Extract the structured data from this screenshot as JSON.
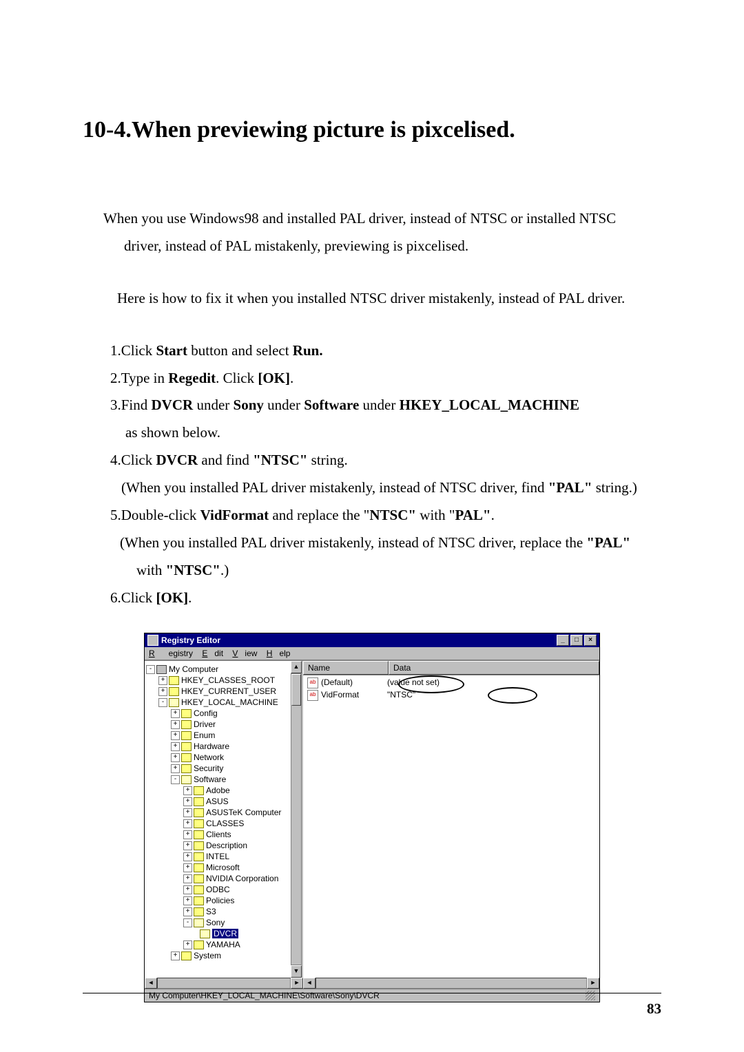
{
  "heading": "10-4.When previewing picture is pixcelised.",
  "p1a": "When you use Windows98 and installed PAL driver, instead of NTSC or installed NTSC",
  "p1b": "driver, instead of PAL mistakenly, previewing is pixcelised.",
  "p2": "Here is how to fix it when you installed NTSC driver mistakenly, instead of PAL driver.",
  "s1_pre": "1.Click ",
  "s1_b1": "Start",
  "s1_mid": " button and select ",
  "s1_b2": "Run.",
  "s2_pre": "2.Type in ",
  "s2_b1": "Regedit",
  "s2_mid": ". Click ",
  "s2_b2": "[OK]",
  "s2_end": ".",
  "s3_pre": "3.Find ",
  "s3_b1": "DVCR",
  "s3_m1": " under ",
  "s3_b2": "Sony",
  "s3_m2": " under ",
  "s3_b3": "Software",
  "s3_m3": " under ",
  "s3_b4": "HKEY_LOCAL_MACHINE",
  "s3_line2": "as shown below.",
  "s4_pre": "4.Click ",
  "s4_b1": "DVCR",
  "s4_mid": " and find ",
  "s4_b2": "\"NTSC\"",
  "s4_end": " string.",
  "s4_note_pre": "(When you installed PAL driver mistakenly, instead of NTSC driver, find ",
  "s4_note_b": "\"PAL\"",
  "s4_note_end": " string.)",
  "s5_pre": "5.Double-click ",
  "s5_b1": "VidFormat",
  "s5_m1": " and replace the \"",
  "s5_b2": "NTSC\"",
  "s5_m2": " with \"",
  "s5_b3": "PAL\"",
  "s5_end": ".",
  "s5_note1_pre": "(When you installed PAL driver mistakenly, instead of NTSC driver, replace the ",
  "s5_note1_b": "\"PAL\"",
  "s5_note2_pre": "with ",
  "s5_note2_b": "\"NTSC\"",
  "s5_note2_end": ".)",
  "s6_pre": "6.Click ",
  "s6_b1": "[OK]",
  "s6_end": ".",
  "regedit": {
    "title": "Registry Editor",
    "menus": {
      "registry": "Registry",
      "edit": "Edit",
      "view": "View",
      "help": "Help"
    },
    "cols": {
      "name": "Name",
      "data": "Data"
    },
    "values": [
      {
        "name": "(Default)",
        "data": "(value not set)"
      },
      {
        "name": "VidFormat",
        "data": "\"NTSC\""
      }
    ],
    "tree": {
      "root": "My Computer",
      "hkcr": "HKEY_CLASSES_ROOT",
      "hkcu": "HKEY_CURRENT_USER",
      "hklm": "HKEY_LOCAL_MACHINE",
      "config": "Config",
      "driver": "Driver",
      "enum": "Enum",
      "hardware": "Hardware",
      "network": "Network",
      "security": "Security",
      "software": "Software",
      "adobe": "Adobe",
      "asus": "ASUS",
      "asustek": "ASUSTeK Computer",
      "classes": "CLASSES",
      "clients": "Clients",
      "description": "Description",
      "intel": "INTEL",
      "microsoft": "Microsoft",
      "nvidia": "NVIDIA Corporation",
      "odbc": "ODBC",
      "policies": "Policies",
      "s3": "S3",
      "sony": "Sony",
      "dvcr": "DVCR",
      "yamaha": "YAMAHA",
      "system": "System"
    },
    "status": "My Computer\\HKEY_LOCAL_MACHINE\\Software\\Sony\\DVCR"
  },
  "page_number": "83"
}
